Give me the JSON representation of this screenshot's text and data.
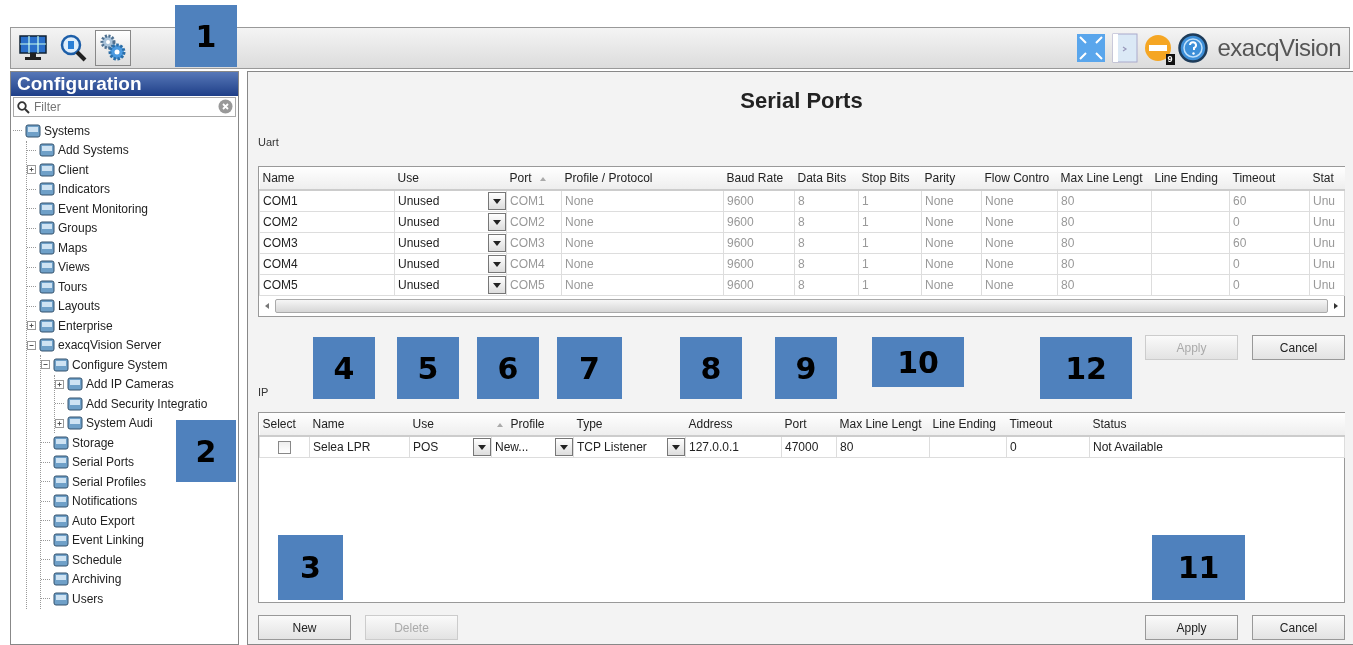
{
  "toolbar": {
    "views": [
      {
        "kind": "live",
        "selected": false
      },
      {
        "kind": "search",
        "selected": false
      },
      {
        "kind": "config",
        "selected": true
      }
    ],
    "status_badge": "9",
    "brand": "exacqVision"
  },
  "sidebar": {
    "title": "Configuration",
    "filter": {
      "placeholder": "Filter"
    },
    "tree": [
      {
        "label": "Systems",
        "children": [
          {
            "label": "Add Systems"
          },
          {
            "label": "Client",
            "expanded": false
          },
          {
            "label": "Indicators"
          },
          {
            "label": "Event Monitoring"
          },
          {
            "label": "Groups"
          },
          {
            "label": "Maps"
          },
          {
            "label": "Views"
          },
          {
            "label": "Tours"
          },
          {
            "label": "Layouts"
          },
          {
            "label": "Enterprise",
            "expanded": false
          },
          {
            "label": "exacqVision Server",
            "expanded": true,
            "children": [
              {
                "label": "Configure System",
                "expanded": true,
                "children": [
                  {
                    "label": "Add IP Cameras",
                    "expanded": false
                  },
                  {
                    "label": "Add Security Integratio"
                  },
                  {
                    "label": "System Audi",
                    "expanded": false
                  }
                ]
              },
              {
                "label": "Storage"
              },
              {
                "label": "Serial Ports"
              },
              {
                "label": "Serial Profiles"
              },
              {
                "label": "Notifications"
              },
              {
                "label": "Auto Export"
              },
              {
                "label": "Event Linking"
              },
              {
                "label": "Schedule"
              },
              {
                "label": "Archiving"
              },
              {
                "label": "Users"
              }
            ]
          }
        ]
      }
    ]
  },
  "page_title": "Serial Ports",
  "uart": {
    "label": "Uart",
    "columns": [
      "Name",
      "Use",
      "Port",
      "Profile / Protocol",
      "Baud Rate",
      "Data Bits",
      "Stop Bits",
      "Parity",
      "Flow Contro",
      "Max Line Lengt",
      "Line Ending",
      "Timeout",
      "Stat"
    ],
    "rows": [
      {
        "name": "COM1",
        "use": "Unused",
        "port": "COM1",
        "profile": "None",
        "baud": "9600",
        "data_bits": "8",
        "stop_bits": "1",
        "parity": "None",
        "flow": "None",
        "max_len": "80",
        "timeout": "60",
        "status": "Unu"
      },
      {
        "name": "COM2",
        "use": "Unused",
        "port": "COM2",
        "profile": "None",
        "baud": "9600",
        "data_bits": "8",
        "stop_bits": "1",
        "parity": "None",
        "flow": "None",
        "max_len": "80",
        "timeout": "0",
        "status": "Unu"
      },
      {
        "name": "COM3",
        "use": "Unused",
        "port": "COM3",
        "profile": "None",
        "baud": "9600",
        "data_bits": "8",
        "stop_bits": "1",
        "parity": "None",
        "flow": "None",
        "max_len": "80",
        "timeout": "60",
        "status": "Unu"
      },
      {
        "name": "COM4",
        "use": "Unused",
        "port": "COM4",
        "profile": "None",
        "baud": "9600",
        "data_bits": "8",
        "stop_bits": "1",
        "parity": "None",
        "flow": "None",
        "max_len": "80",
        "timeout": "0",
        "status": "Unu"
      },
      {
        "name": "COM5",
        "use": "Unused",
        "port": "COM5",
        "profile": "None",
        "baud": "9600",
        "data_bits": "8",
        "stop_bits": "1",
        "parity": "None",
        "flow": "None",
        "max_len": "80",
        "timeout": "0",
        "status": "Unu"
      }
    ],
    "buttons": [
      {
        "label": "Apply",
        "disabled": true
      },
      {
        "label": "Cancel",
        "disabled": false
      }
    ]
  },
  "ip": {
    "label": "IP",
    "columns": [
      "Select",
      "Name",
      "Use",
      "Profile",
      "Type",
      "Address",
      "Port",
      "Max Line Lengt",
      "Line Ending",
      "Timeout",
      "Status"
    ],
    "rows": [
      {
        "selected": false,
        "name": "Selea LPR",
        "use": "POS",
        "profile": "New...",
        "type": "TCP Listener",
        "address": "127.0.0.1",
        "port": "47000",
        "max_len": "80",
        "timeout": "0",
        "status": "Not Available"
      }
    ],
    "left_buttons": [
      {
        "label": "New",
        "disabled": false
      },
      {
        "label": "Delete",
        "disabled": true
      }
    ],
    "right_buttons": [
      {
        "label": "Apply",
        "disabled": false
      },
      {
        "label": "Cancel",
        "disabled": false
      }
    ]
  },
  "callouts": [
    {
      "label": "1"
    },
    {
      "label": "2"
    },
    {
      "label": "3"
    },
    {
      "label": "4"
    },
    {
      "label": "5"
    },
    {
      "label": "6"
    },
    {
      "label": "7"
    },
    {
      "label": "8"
    },
    {
      "label": "9"
    },
    {
      "label": "10"
    },
    {
      "label": "11"
    },
    {
      "label": "12"
    }
  ]
}
